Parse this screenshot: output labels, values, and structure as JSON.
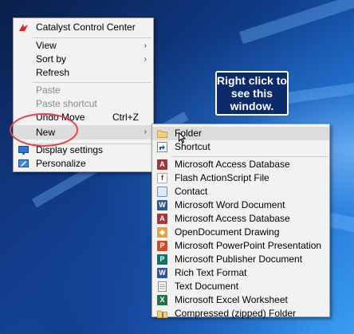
{
  "context_menu": {
    "items": [
      {
        "label": "Catalyst Control Center",
        "icon": "catalyst-icon"
      },
      {
        "label": "View",
        "submenu": true
      },
      {
        "label": "Sort by",
        "submenu": true
      },
      {
        "label": "Refresh"
      },
      {
        "label": "Paste",
        "disabled": true
      },
      {
        "label": "Paste shortcut",
        "disabled": true
      },
      {
        "label": "Undo Move",
        "shortcut": "Ctrl+Z"
      },
      {
        "label": "New",
        "submenu": true,
        "highlighted": true
      },
      {
        "label": "Display settings",
        "icon": "display-settings-icon"
      },
      {
        "label": "Personalize",
        "icon": "personalize-icon"
      }
    ]
  },
  "new_submenu": {
    "items": [
      {
        "label": "Folder",
        "icon": "folder-icon",
        "highlighted": true
      },
      {
        "label": "Shortcut",
        "icon": "shortcut-icon"
      },
      {
        "label": "Microsoft Access Database",
        "icon": "access-icon"
      },
      {
        "label": "Flash ActionScript File",
        "icon": "flash-file-icon"
      },
      {
        "label": "Contact",
        "icon": "contact-icon"
      },
      {
        "label": "Microsoft Word Document",
        "icon": "word-icon"
      },
      {
        "label": "Microsoft Access Database",
        "icon": "access-icon"
      },
      {
        "label": "OpenDocument Drawing",
        "icon": "odg-icon"
      },
      {
        "label": "Microsoft PowerPoint Presentation",
        "icon": "powerpoint-icon"
      },
      {
        "label": "Microsoft Publisher Document",
        "icon": "publisher-icon"
      },
      {
        "label": "Rich Text Format",
        "icon": "rtf-icon"
      },
      {
        "label": "Text Document",
        "icon": "text-document-icon"
      },
      {
        "label": "Microsoft Excel Worksheet",
        "icon": "excel-icon"
      },
      {
        "label": "Compressed (zipped) Folder",
        "icon": "zip-folder-icon"
      }
    ]
  },
  "callout": {
    "text": "Right click to see this window."
  },
  "colors": {
    "callout_bg": "#0b2a6a",
    "highlight_ring": "#e3424a",
    "menu_bg": "#f2f2f2"
  }
}
